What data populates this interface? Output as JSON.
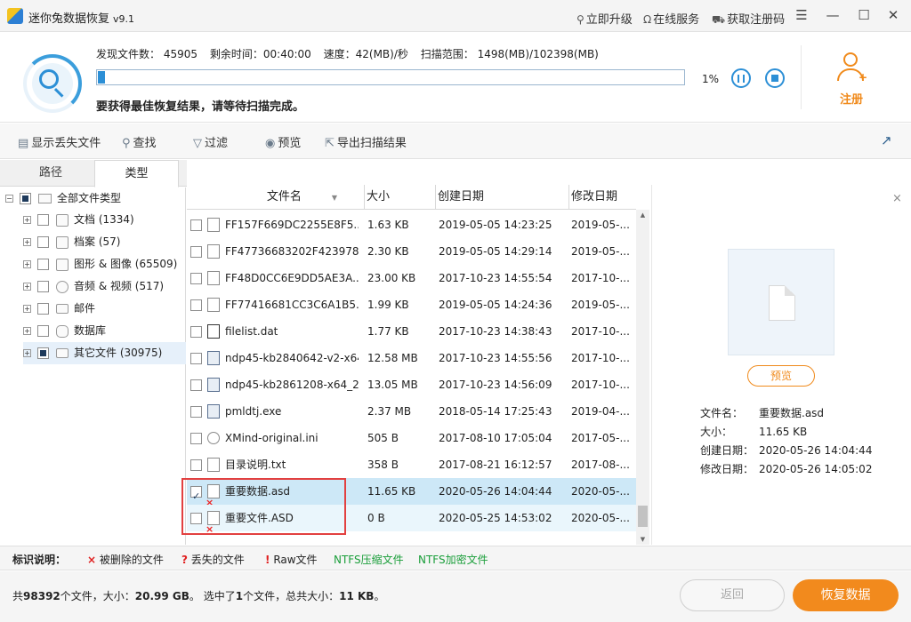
{
  "window": {
    "title": "迷你兔数据恢复",
    "version": "v9.1",
    "links": [
      {
        "label": "立即升级",
        "icon": "search-icon"
      },
      {
        "label": "在线服务",
        "icon": "headset-icon"
      },
      {
        "label": "获取注册码",
        "icon": "cart-icon"
      }
    ],
    "menu_icon": "☰",
    "minimize_icon": "—",
    "maximize_icon": "☐",
    "close_icon": "✕"
  },
  "scan": {
    "found_label": "发现文件数：",
    "found_value": "45905",
    "remain_label": "剩余时间：",
    "remain_value": "00:40:00",
    "speed_label": "速度：",
    "speed_value": "42(MB)/秒",
    "range_label": "扫描范围：",
    "range_value": "1498(MB)/102398(MB)",
    "progress_percent": 1,
    "progress_text": "1%",
    "tip": "要获得最佳恢复结果，请等待扫描完成。"
  },
  "register": {
    "label": "注册"
  },
  "toolbar": {
    "show_lost": "显示丢失文件",
    "find": "查找",
    "filter": "过滤",
    "preview": "预览",
    "export": "导出扫描结果"
  },
  "tabs": {
    "path": "路径",
    "type": "类型"
  },
  "tree": {
    "root": "全部文件类型",
    "items": [
      {
        "label": "文档 (1334)"
      },
      {
        "label": "档案 (57)"
      },
      {
        "label": "图形 & 图像 (65509)"
      },
      {
        "label": "音频 & 视频 (517)"
      },
      {
        "label": "邮件"
      },
      {
        "label": "数据库"
      },
      {
        "label": "其它文件 (30975)"
      }
    ]
  },
  "grid": {
    "columns": {
      "name": "文件名",
      "size": "大小",
      "created": "创建日期",
      "modified": "修改日期"
    },
    "rows": [
      {
        "name": "FF157F669DC2255E8F5...",
        "size": "1.63 KB",
        "created": "2019-05-05 14:23:25",
        "modified": "2019-05-...",
        "kind": "file",
        "checked": false,
        "deleted": false
      },
      {
        "name": "FF47736683202F423978...",
        "size": "2.30 KB",
        "created": "2019-05-05 14:29:14",
        "modified": "2019-05-...",
        "kind": "file",
        "checked": false,
        "deleted": false
      },
      {
        "name": "FF48D0CC6E9DD5AE3A...",
        "size": "23.00 KB",
        "created": "2017-10-23 14:55:54",
        "modified": "2017-10-...",
        "kind": "file",
        "checked": false,
        "deleted": false
      },
      {
        "name": "FF77416681CC3C6A1B5...",
        "size": "1.99 KB",
        "created": "2019-05-05 14:24:36",
        "modified": "2019-05-...",
        "kind": "file",
        "checked": false,
        "deleted": false
      },
      {
        "name": "filelist.dat",
        "size": "1.77 KB",
        "created": "2017-10-23 14:38:43",
        "modified": "2017-10-...",
        "kind": "dat",
        "checked": false,
        "deleted": false
      },
      {
        "name": "ndp45-kb2840642-v2-x64...",
        "size": "12.58 MB",
        "created": "2017-10-23 14:55:56",
        "modified": "2017-10-...",
        "kind": "exe",
        "checked": false,
        "deleted": false
      },
      {
        "name": "ndp45-kb2861208-x64_2...",
        "size": "13.05 MB",
        "created": "2017-10-23 14:56:09",
        "modified": "2017-10-...",
        "kind": "exe",
        "checked": false,
        "deleted": false
      },
      {
        "name": "pmldtj.exe",
        "size": "2.37 MB",
        "created": "2018-05-14 17:25:43",
        "modified": "2019-04-...",
        "kind": "exe",
        "checked": false,
        "deleted": false
      },
      {
        "name": "XMind-original.ini",
        "size": "505 B",
        "created": "2017-08-10 17:05:04",
        "modified": "2017-05-...",
        "kind": "ini",
        "checked": false,
        "deleted": false
      },
      {
        "name": "目录说明.txt",
        "size": "358 B",
        "created": "2017-08-21 16:12:57",
        "modified": "2017-08-...",
        "kind": "file",
        "checked": false,
        "deleted": false
      },
      {
        "name": "重要数据.asd",
        "size": "11.65 KB",
        "created": "2020-05-26 14:04:44",
        "modified": "2020-05-...",
        "kind": "file",
        "checked": true,
        "deleted": true,
        "state": "selected"
      },
      {
        "name": "重要文件.ASD",
        "size": "0 B",
        "created": "2020-05-25 14:53:02",
        "modified": "2020-05-...",
        "kind": "file",
        "checked": false,
        "deleted": true,
        "state": "alt"
      }
    ]
  },
  "preview": {
    "button": "预览",
    "name_label": "文件名：",
    "name_value": "重要数据.asd",
    "size_label": "大小：",
    "size_value": "11.65 KB",
    "created_label": "创建日期：",
    "created_value": "2020-05-26 14:04:44",
    "modified_label": "修改日期：",
    "modified_value": "2020-05-26 14:05:02"
  },
  "legend": {
    "title": "标识说明：",
    "items": [
      {
        "mark": "×",
        "label": "被删除的文件",
        "color": "#e02020"
      },
      {
        "mark": "?",
        "label": "丢失的文件",
        "color": "#e02020"
      },
      {
        "mark": "!",
        "label": "Raw文件",
        "color": "#e02020"
      },
      {
        "mark": "",
        "label": "NTFS压缩文件",
        "color": "#1a9e3a"
      },
      {
        "mark": "",
        "label": "NTFS加密文件",
        "color": "#1a9e3a"
      }
    ]
  },
  "status": {
    "t1": "共",
    "total_files": "98392",
    "t2": "个文件，大小：",
    "total_size": "20.99 GB",
    "t3": "。 选中了",
    "sel_count": "1",
    "t4": "个文件，总共大小：",
    "sel_size": "11 KB",
    "t5": "。",
    "back": "返回",
    "recover": "恢复数据"
  },
  "colors": {
    "accent": "#2c8fd6",
    "orange": "#f28a1d",
    "highlight": "#e24040"
  }
}
